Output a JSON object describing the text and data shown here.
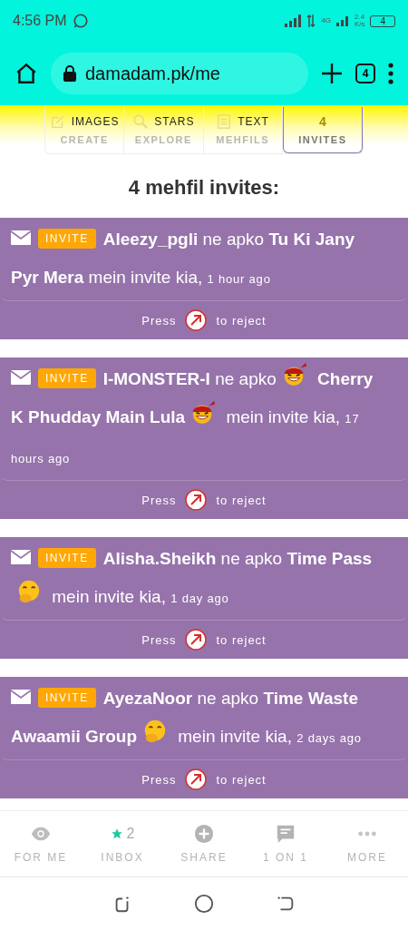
{
  "status_bar": {
    "time": "4:56 PM",
    "network": "4G",
    "speed": "2.4",
    "speed_unit": "K/s",
    "battery": "4"
  },
  "browser": {
    "url": "damadam.pk/me",
    "tab_count": "4"
  },
  "tabs": [
    {
      "label": "CREATE",
      "top_label": "IMAGES",
      "selected": false
    },
    {
      "label": "EXPLORE",
      "top_label": "STARS",
      "selected": false
    },
    {
      "label": "MEHFILS",
      "top_label": "TEXT",
      "selected": false
    },
    {
      "label": "INVITES",
      "count": "4",
      "selected": true
    }
  ],
  "heading": "4 mehfil invites:",
  "invites": [
    {
      "badge": "INVITE",
      "parts": [
        {
          "kind": "bold",
          "text": "Aleezy_pgli"
        },
        {
          "kind": "plain",
          "text": "ne apko"
        },
        {
          "kind": "bold",
          "text": "Tu Ki Jany"
        },
        {
          "kind": "bold",
          "text": "Pyr Mera"
        },
        {
          "kind": "plain",
          "text": "mein invite kia,"
        },
        {
          "kind": "time",
          "text": "1 hour ago"
        }
      ],
      "press": "Press",
      "reject": "to reject"
    },
    {
      "badge": "INVITE",
      "parts": [
        {
          "kind": "bold",
          "text": "I-MONSTER-I"
        },
        {
          "kind": "plain",
          "text": "ne apko"
        },
        {
          "kind": "bandana-emoji"
        },
        {
          "kind": "bold",
          "text": "Cherry"
        },
        {
          "kind": "bold",
          "text": "K Phudday Main Lula"
        },
        {
          "kind": "bandana-emoji"
        },
        {
          "kind": "plain",
          "text": "mein invite kia,"
        },
        {
          "kind": "time",
          "text": "17"
        },
        {
          "kind": "time",
          "text": "hours ago"
        }
      ],
      "press": "Press",
      "reject": "to reject"
    },
    {
      "badge": "INVITE",
      "parts": [
        {
          "kind": "bold",
          "text": "Alisha.Sheikh"
        },
        {
          "kind": "plain",
          "text": "ne apko"
        },
        {
          "kind": "bold",
          "text": "Time Pass"
        },
        {
          "kind": "giggle-emoji"
        },
        {
          "kind": "plain",
          "text": "mein invite kia,"
        },
        {
          "kind": "time",
          "text": "1 day ago"
        }
      ],
      "press": "Press",
      "reject": "to reject"
    },
    {
      "badge": "INVITE",
      "parts": [
        {
          "kind": "bold",
          "text": "AyezaNoor"
        },
        {
          "kind": "plain",
          "text": "ne apko"
        },
        {
          "kind": "bold",
          "text": "Time Waste"
        },
        {
          "kind": "bold",
          "text": "Awaamii Group"
        },
        {
          "kind": "giggle-emoji"
        },
        {
          "kind": "plain",
          "text": "mein invite kia,"
        },
        {
          "kind": "time",
          "text": "2 days ago"
        }
      ],
      "press": "Press",
      "reject": "to reject"
    }
  ],
  "bottom_nav": [
    {
      "label": "FOR ME"
    },
    {
      "label": "INBOX",
      "count": "2"
    },
    {
      "label": "SHARE"
    },
    {
      "label": "1 ON 1"
    },
    {
      "label": "MORE"
    }
  ]
}
